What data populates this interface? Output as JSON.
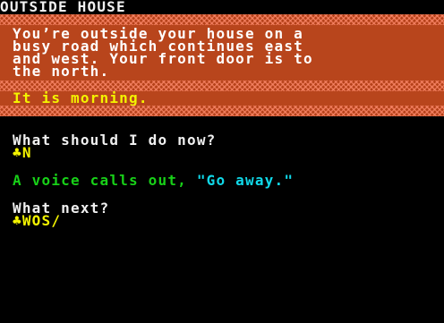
{
  "location_title": "OUTSIDE HOUSE",
  "description_lines": [
    "You’re outside your house on a",
    "busy road which continues east",
    "and west. Your front door is to",
    "the north."
  ],
  "time_text": "It is morning.",
  "prompt_1": "What should I do now?",
  "input_1": "N",
  "voice_prefix": "A voice calls out, ",
  "voice_quote": "\"Go away.\"",
  "prompt_2": "What next?",
  "input_2": "WOS",
  "prompt_glyph": "♣",
  "cursor_glyph": "/",
  "colors": {
    "background": "#000000",
    "stripe": "#b8451c",
    "text_white": "#f0f0f0",
    "text_yellow": "#f4f400",
    "text_green": "#18d018",
    "text_cyan": "#10d8e8"
  }
}
